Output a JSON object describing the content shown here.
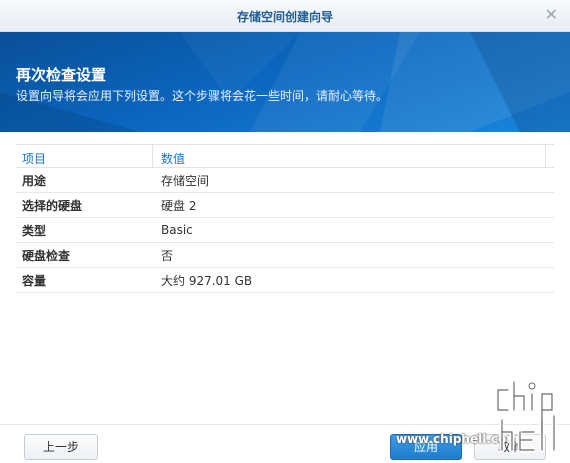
{
  "window": {
    "title": "存储空间创建向导"
  },
  "banner": {
    "heading": "再次检查设置",
    "subtitle": "设置向导将会应用下列设置。这个步骤将会花一些时间，请耐心等待。"
  },
  "table": {
    "headers": [
      "项目",
      "数值"
    ],
    "rows": [
      {
        "key": "用途",
        "value": "存储空间"
      },
      {
        "key": "选择的硬盘",
        "value": "硬盘 2"
      },
      {
        "key": "类型",
        "value": "Basic"
      },
      {
        "key": "硬盘检查",
        "value": "否"
      },
      {
        "key": "容量",
        "value": "大约 927.01 GB"
      }
    ]
  },
  "buttons": {
    "prev": "上一步",
    "apply": "应用",
    "cancel": "取消"
  },
  "watermark": {
    "url": "www.chiphell.com",
    "logo_text": "chip hell"
  },
  "colors": {
    "banner": "#0b66bf",
    "accent": "#1a73c8",
    "title": "#1f5c93"
  }
}
